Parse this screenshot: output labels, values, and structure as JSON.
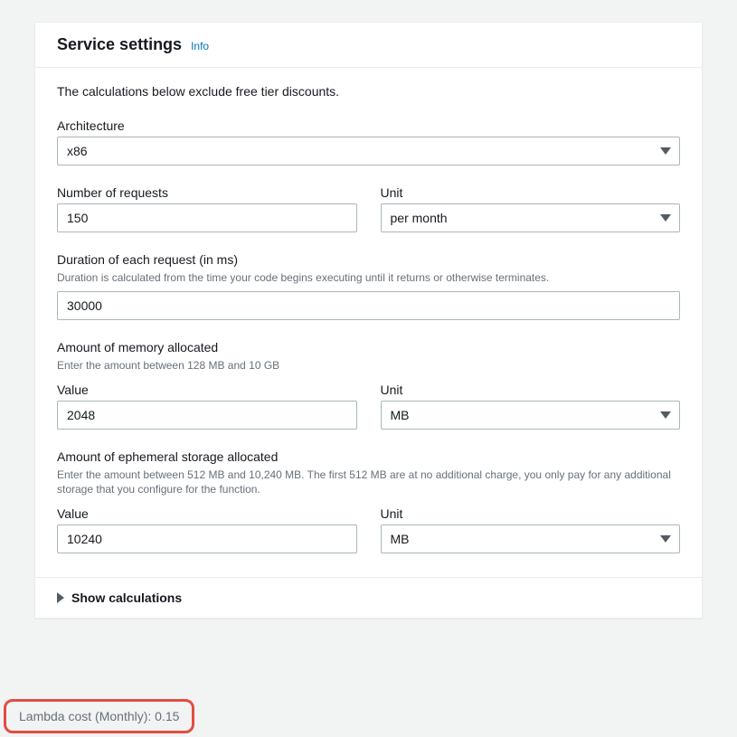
{
  "header": {
    "title": "Service settings",
    "info_link": "Info"
  },
  "note": "The calculations below exclude free tier discounts.",
  "architecture": {
    "label": "Architecture",
    "value": "x86"
  },
  "requests": {
    "label": "Number of requests",
    "value": "150",
    "unit_label": "Unit",
    "unit_value": "per month"
  },
  "duration": {
    "label": "Duration of each request (in ms)",
    "hint": "Duration is calculated from the time your code begins executing until it returns or otherwise terminates.",
    "value": "30000"
  },
  "memory": {
    "label": "Amount of memory allocated",
    "hint": "Enter the amount between 128 MB and 10 GB",
    "value_label": "Value",
    "value": "2048",
    "unit_label": "Unit",
    "unit_value": "MB"
  },
  "storage": {
    "label": "Amount of ephemeral storage allocated",
    "hint": "Enter the amount between 512 MB and 10,240 MB. The first 512 MB are at no additional charge, you only pay for any additional storage that you configure for the function.",
    "value_label": "Value",
    "value": "10240",
    "unit_label": "Unit",
    "unit_value": "MB"
  },
  "footer": {
    "show_calc": "Show calculations"
  },
  "cost": {
    "text": "Lambda cost (Monthly): 0.15"
  }
}
